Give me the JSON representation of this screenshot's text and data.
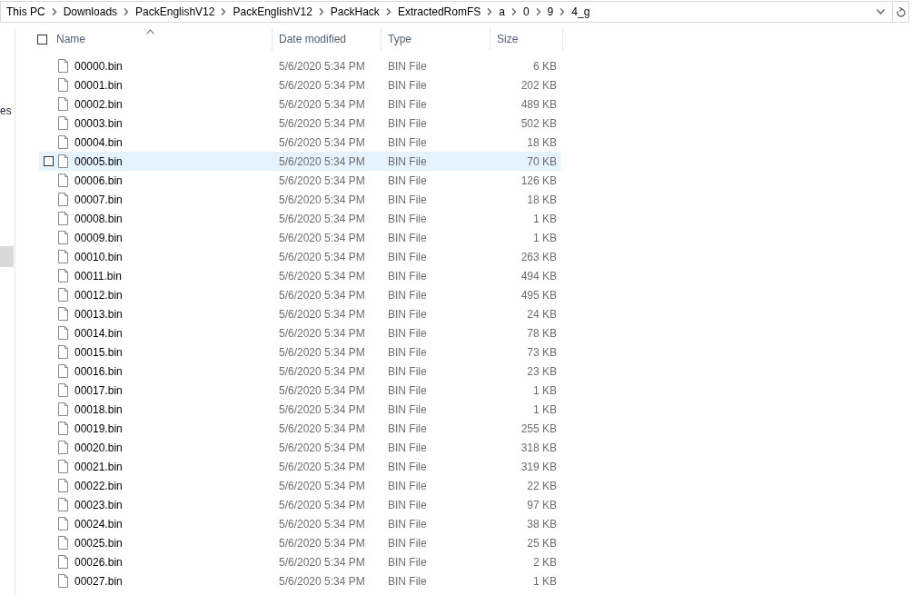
{
  "address_bar": {
    "breadcrumbs": [
      "This PC",
      "Downloads",
      "PackEnglishV12",
      "PackEnglishV12",
      "PackHack",
      "ExtractedRomFS",
      "a",
      "0",
      "9",
      "4_g"
    ]
  },
  "nav_pane": {
    "items": [
      {
        "label": "es"
      }
    ]
  },
  "table": {
    "select_all": {
      "checked": false
    },
    "columns": [
      {
        "label": "Name",
        "sorted": true
      },
      {
        "label": "Date modified",
        "sorted": false
      },
      {
        "label": "Type",
        "sorted": false
      },
      {
        "label": "Size",
        "sorted": false
      }
    ],
    "rows": [
      {
        "name": "00000.bin",
        "date": "5/6/2020 5:34 PM",
        "type": "BIN File",
        "size": "6 KB",
        "hovered": false
      },
      {
        "name": "00001.bin",
        "date": "5/6/2020 5:34 PM",
        "type": "BIN File",
        "size": "202 KB",
        "hovered": false
      },
      {
        "name": "00002.bin",
        "date": "5/6/2020 5:34 PM",
        "type": "BIN File",
        "size": "489 KB",
        "hovered": false
      },
      {
        "name": "00003.bin",
        "date": "5/6/2020 5:34 PM",
        "type": "BIN File",
        "size": "502 KB",
        "hovered": false
      },
      {
        "name": "00004.bin",
        "date": "5/6/2020 5:34 PM",
        "type": "BIN File",
        "size": "18 KB",
        "hovered": false
      },
      {
        "name": "00005.bin",
        "date": "5/6/2020 5:34 PM",
        "type": "BIN File",
        "size": "70 KB",
        "hovered": true
      },
      {
        "name": "00006.bin",
        "date": "5/6/2020 5:34 PM",
        "type": "BIN File",
        "size": "126 KB",
        "hovered": false
      },
      {
        "name": "00007.bin",
        "date": "5/6/2020 5:34 PM",
        "type": "BIN File",
        "size": "18 KB",
        "hovered": false
      },
      {
        "name": "00008.bin",
        "date": "5/6/2020 5:34 PM",
        "type": "BIN File",
        "size": "1 KB",
        "hovered": false
      },
      {
        "name": "00009.bin",
        "date": "5/6/2020 5:34 PM",
        "type": "BIN File",
        "size": "1 KB",
        "hovered": false
      },
      {
        "name": "00010.bin",
        "date": "5/6/2020 5:34 PM",
        "type": "BIN File",
        "size": "263 KB",
        "hovered": false
      },
      {
        "name": "00011.bin",
        "date": "5/6/2020 5:34 PM",
        "type": "BIN File",
        "size": "494 KB",
        "hovered": false
      },
      {
        "name": "00012.bin",
        "date": "5/6/2020 5:34 PM",
        "type": "BIN File",
        "size": "495 KB",
        "hovered": false
      },
      {
        "name": "00013.bin",
        "date": "5/6/2020 5:34 PM",
        "type": "BIN File",
        "size": "24 KB",
        "hovered": false
      },
      {
        "name": "00014.bin",
        "date": "5/6/2020 5:34 PM",
        "type": "BIN File",
        "size": "78 KB",
        "hovered": false
      },
      {
        "name": "00015.bin",
        "date": "5/6/2020 5:34 PM",
        "type": "BIN File",
        "size": "73 KB",
        "hovered": false
      },
      {
        "name": "00016.bin",
        "date": "5/6/2020 5:34 PM",
        "type": "BIN File",
        "size": "23 KB",
        "hovered": false
      },
      {
        "name": "00017.bin",
        "date": "5/6/2020 5:34 PM",
        "type": "BIN File",
        "size": "1 KB",
        "hovered": false
      },
      {
        "name": "00018.bin",
        "date": "5/6/2020 5:34 PM",
        "type": "BIN File",
        "size": "1 KB",
        "hovered": false
      },
      {
        "name": "00019.bin",
        "date": "5/6/2020 5:34 PM",
        "type": "BIN File",
        "size": "255 KB",
        "hovered": false
      },
      {
        "name": "00020.bin",
        "date": "5/6/2020 5:34 PM",
        "type": "BIN File",
        "size": "318 KB",
        "hovered": false
      },
      {
        "name": "00021.bin",
        "date": "5/6/2020 5:34 PM",
        "type": "BIN File",
        "size": "319 KB",
        "hovered": false
      },
      {
        "name": "00022.bin",
        "date": "5/6/2020 5:34 PM",
        "type": "BIN File",
        "size": "22 KB",
        "hovered": false
      },
      {
        "name": "00023.bin",
        "date": "5/6/2020 5:34 PM",
        "type": "BIN File",
        "size": "97 KB",
        "hovered": false
      },
      {
        "name": "00024.bin",
        "date": "5/6/2020 5:34 PM",
        "type": "BIN File",
        "size": "38 KB",
        "hovered": false
      },
      {
        "name": "00025.bin",
        "date": "5/6/2020 5:34 PM",
        "type": "BIN File",
        "size": "25 KB",
        "hovered": false
      },
      {
        "name": "00026.bin",
        "date": "5/6/2020 5:34 PM",
        "type": "BIN File",
        "size": "2 KB",
        "hovered": false
      },
      {
        "name": "00027.bin",
        "date": "5/6/2020 5:34 PM",
        "type": "BIN File",
        "size": "1 KB",
        "hovered": false
      }
    ]
  }
}
